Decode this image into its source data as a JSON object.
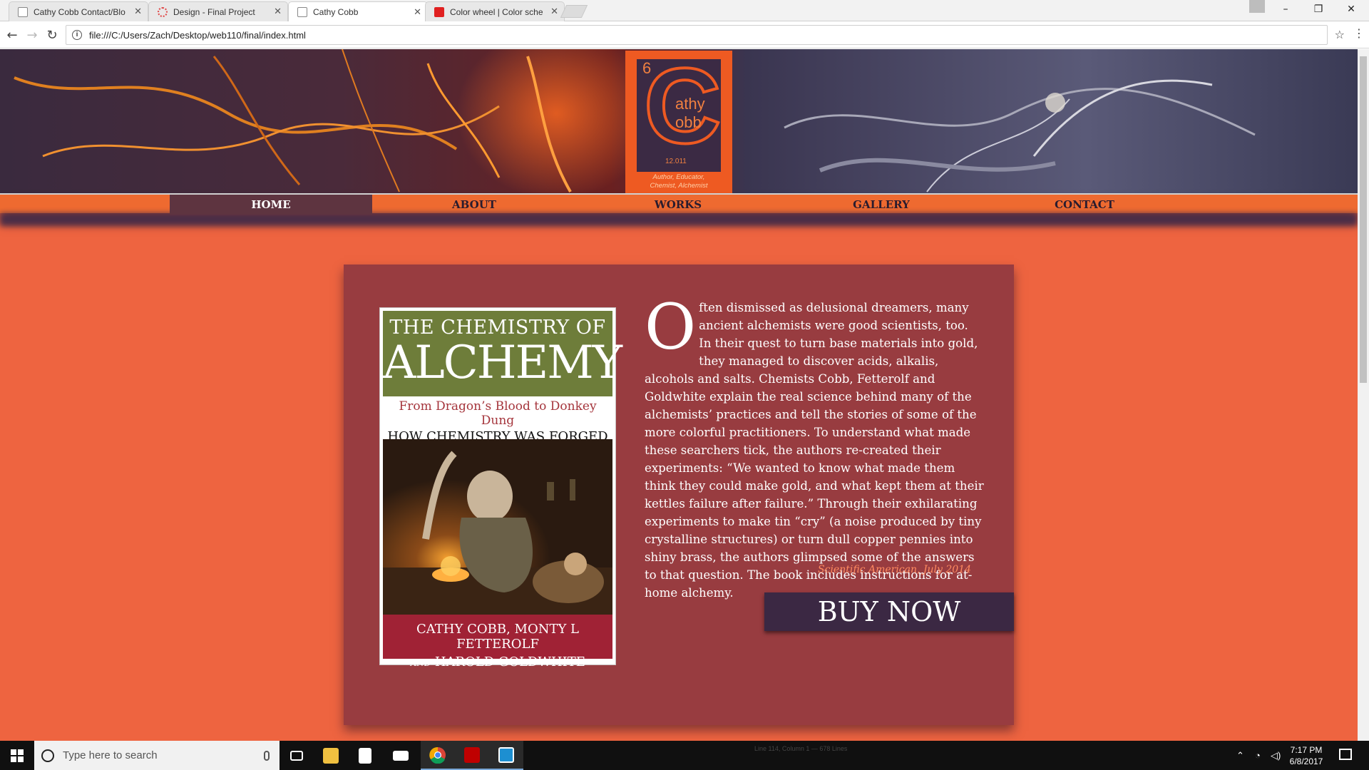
{
  "browser": {
    "tabs": [
      {
        "title": "Cathy Cobb Contact/Blo",
        "favicon_color": "#888888",
        "active": false
      },
      {
        "title": "Design - Final Project",
        "favicon_color": "#e04848",
        "active": false
      },
      {
        "title": "Cathy Cobb",
        "favicon_color": "#888888",
        "active": true
      },
      {
        "title": "Color wheel | Color sche",
        "favicon_color": "#e02020",
        "active": false
      }
    ],
    "close_glyph": "✕",
    "url": "file:///C:/Users/Zach/Desktop/web110/final/index.html",
    "window_controls": {
      "minimize": "–",
      "maximize": "❐",
      "close": "✕"
    }
  },
  "site": {
    "logo": {
      "number": "6",
      "letter": "C",
      "first_rest": "athy",
      "last_rest": "obb",
      "date": "12.011",
      "tagline_1": "Author, Educator,",
      "tagline_2": "Chemist, Alchemist",
      "colors": {
        "orange": "#ee5a22",
        "purple": "#3b2a44"
      }
    },
    "nav": [
      {
        "label": "HOME",
        "active": true
      },
      {
        "label": "ABOUT",
        "active": false
      },
      {
        "label": "WORKS",
        "active": false
      },
      {
        "label": "GALLERY",
        "active": false
      },
      {
        "label": "CONTACT",
        "active": false
      }
    ],
    "book": {
      "title_line1": "THE CHEMISTRY OF",
      "title_line2": "ALCHEMY",
      "subtitle_line1": "From Dragon’s Blood to Donkey Dung",
      "subtitle_line2": "HOW CHEMISTRY WAS FORGED",
      "authors_line1": "CATHY COBB, MONTY L FETTEROLF",
      "authors_and": "AND",
      "authors_line2": "HAROLD GOLDWHITE"
    },
    "blurb": {
      "dropcap": "O",
      "text": "ften dismissed as delusional dreamers, many ancient alchemists were good scientists, too. In their quest to turn base materials into gold, they managed to discover acids, alkalis, alcohols and salts. Chemists Cobb, Fetterolf and Goldwhite explain the real science behind many of the alchemists’ practices and tell the stories of some of the more colorful practitioners. To understand what made these searchers tick, the authors re-created their experiments: “We wanted to know what made them think they could make gold, and what kept them at their kettles failure after failure.” Through their exhilarating experiments to make tin “cry” (a noise produced by tiny crystalline structures) or turn dull copper pennies into shiny brass, the authors glimpsed some of the answers to that question. The book includes instructions for at-home alchemy.",
      "citation": "Scientific American, July 2014"
    },
    "buy_button": "BUY NOW",
    "colors": {
      "page_bg": "#ee6440",
      "card_bg": "#983c40",
      "nav_bg": "#ee6a30",
      "nav_active": "#5e3440",
      "button_bg": "#3b2843"
    }
  },
  "taskbar": {
    "search_placeholder": "Type here to search",
    "time": "7:17 PM",
    "date": "6/8/2017",
    "ghost_text": "Line 114, Column 1 — 678 Lines",
    "icons": [
      "windows-start-icon",
      "task-view-icon",
      "file-explorer-icon",
      "store-icon",
      "mail-icon",
      "chrome-icon",
      "filezilla-icon",
      "brackets-icon"
    ]
  }
}
